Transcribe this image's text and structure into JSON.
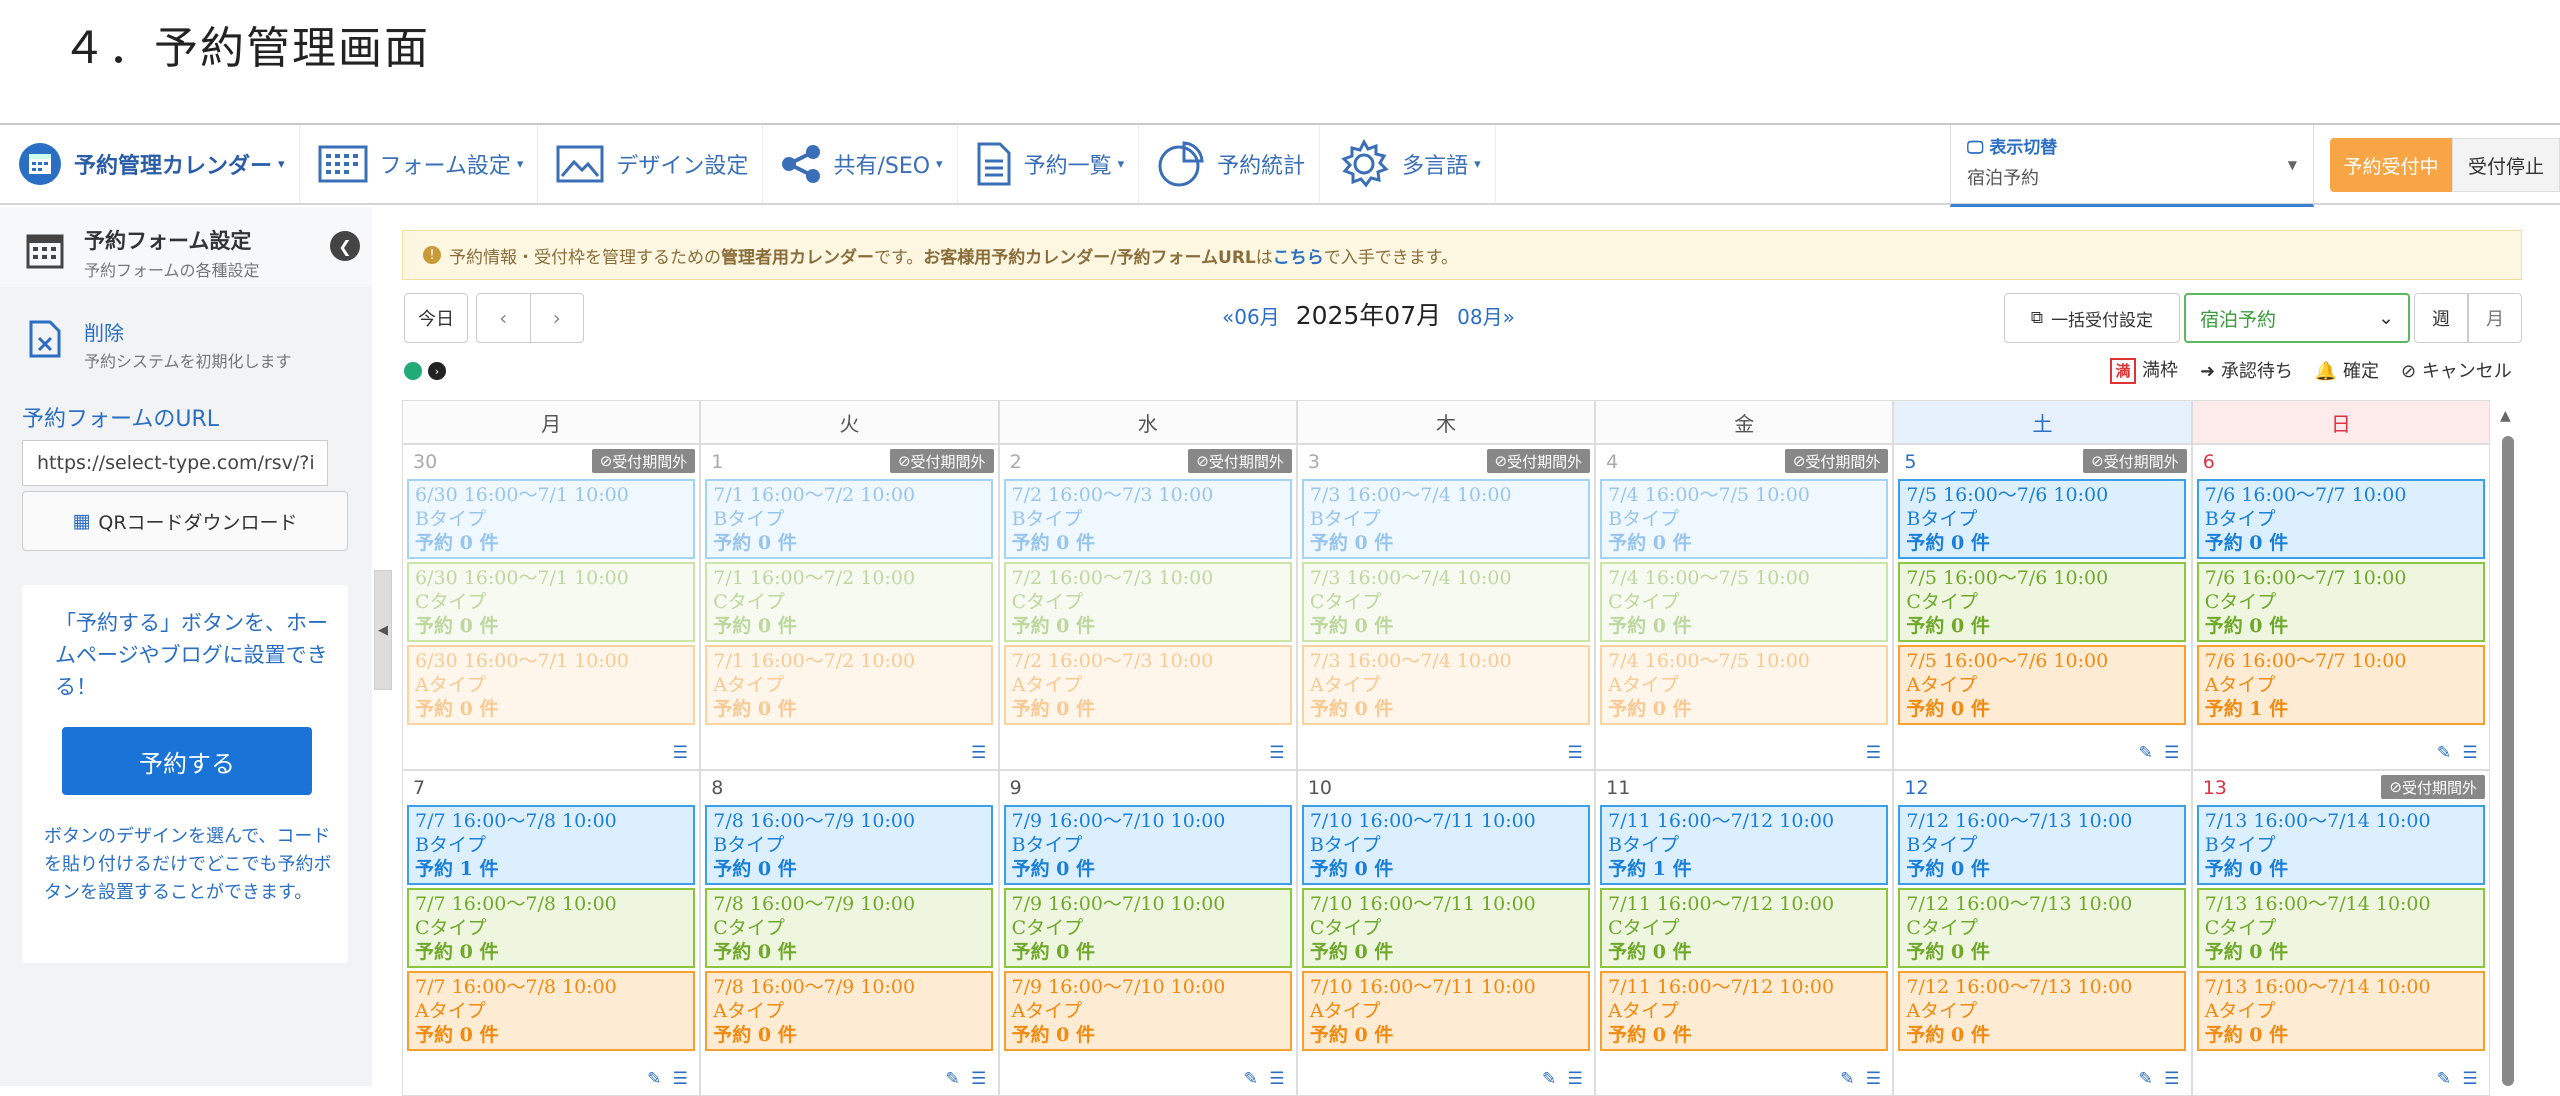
{
  "page_heading": "４．予約管理画面",
  "nav": {
    "items": [
      {
        "label": "予約管理カレンダー",
        "caret": "▾",
        "icon": "calendar-icon"
      },
      {
        "label": "フォーム設定",
        "caret": "▾",
        "icon": "form-grid-icon"
      },
      {
        "label": "デザイン設定",
        "caret": "",
        "icon": "image-frame-icon"
      },
      {
        "label": "共有/SEO",
        "caret": "▾",
        "icon": "share-icon"
      },
      {
        "label": "予約一覧",
        "caret": "▾",
        "icon": "document-icon"
      },
      {
        "label": "予約統計",
        "caret": "",
        "icon": "pie-chart-icon"
      },
      {
        "label": "多言語",
        "caret": "▾",
        "icon": "gear-icon"
      }
    ],
    "display_switch": {
      "label": "表示切替",
      "value": "宿泊予約"
    },
    "accepting_label": "予約受付中",
    "stop_label": "受付停止"
  },
  "sidebar": {
    "form_settings": {
      "title": "予約フォーム設定",
      "sub": "予約フォームの各種設定"
    },
    "delete": {
      "title": "削除",
      "sub": "予約システムを初期化します"
    },
    "url_label": "予約フォームのURL",
    "url_value": "https://select-type.com/rsv/?id",
    "qr_label": "QRコードダウンロード",
    "promo": {
      "text": "「予約する」ボタンを、ホームページやブログに設置できる！",
      "button": "予約する",
      "desc": "ボタンのデザインを選んで、コードを貼り付けるだけでどこでも予約ボタンを設置することができます。"
    }
  },
  "notice": {
    "prefix": "予約情報・受付枠を管理するための",
    "bold1": "管理者用カレンダー",
    "mid": "です。",
    "bold2": "お客様用予約カレンダー/予約フォームURL",
    "mid2": "は",
    "link": "こちら",
    "suffix": "で入手できます。"
  },
  "toolbar": {
    "today": "今日",
    "prev_month": "«06月",
    "current_month": "2025年07月",
    "next_month": "08月»",
    "bulk_label": "一括受付設定",
    "type_select": "宿泊予約",
    "week": "週",
    "month": "月"
  },
  "legend": {
    "full": "満",
    "full_label": "満枠",
    "pending": "承認待ち",
    "confirmed": "確定",
    "cancel": "キャンセル"
  },
  "calendar": {
    "weekdays": [
      "月",
      "火",
      "水",
      "木",
      "金",
      "土",
      "日"
    ],
    "out_of_period": "受付期間外",
    "weeks": [
      [
        {
          "num": "30",
          "past": true,
          "out": true,
          "slots": [
            {
              "type": "b",
              "time": "6/30 16:00～7/1 10:00",
              "name": "Bタイプ",
              "count": "予約 0 件"
            },
            {
              "type": "c",
              "time": "6/30 16:00～7/1 10:00",
              "name": "Cタイプ",
              "count": "予約 0 件"
            },
            {
              "type": "a",
              "time": "6/30 16:00～7/1 10:00",
              "name": "Aタイプ",
              "count": "予約 0 件"
            }
          ]
        },
        {
          "num": "1",
          "past": true,
          "out": true,
          "slots": [
            {
              "type": "b",
              "time": "7/1 16:00～7/2 10:00",
              "name": "Bタイプ",
              "count": "予約 0 件"
            },
            {
              "type": "c",
              "time": "7/1 16:00～7/2 10:00",
              "name": "Cタイプ",
              "count": "予約 0 件"
            },
            {
              "type": "a",
              "time": "7/1 16:00～7/2 10:00",
              "name": "Aタイプ",
              "count": "予約 0 件"
            }
          ]
        },
        {
          "num": "2",
          "past": true,
          "out": true,
          "slots": [
            {
              "type": "b",
              "time": "7/2 16:00～7/3 10:00",
              "name": "Bタイプ",
              "count": "予約 0 件"
            },
            {
              "type": "c",
              "time": "7/2 16:00～7/3 10:00",
              "name": "Cタイプ",
              "count": "予約 0 件"
            },
            {
              "type": "a",
              "time": "7/2 16:00～7/3 10:00",
              "name": "Aタイプ",
              "count": "予約 0 件"
            }
          ]
        },
        {
          "num": "3",
          "past": true,
          "out": true,
          "slots": [
            {
              "type": "b",
              "time": "7/3 16:00～7/4 10:00",
              "name": "Bタイプ",
              "count": "予約 0 件"
            },
            {
              "type": "c",
              "time": "7/3 16:00～7/4 10:00",
              "name": "Cタイプ",
              "count": "予約 0 件"
            },
            {
              "type": "a",
              "time": "7/3 16:00～7/4 10:00",
              "name": "Aタイプ",
              "count": "予約 0 件"
            }
          ]
        },
        {
          "num": "4",
          "past": true,
          "out": true,
          "slots": [
            {
              "type": "b",
              "time": "7/4 16:00～7/5 10:00",
              "name": "Bタイプ",
              "count": "予約 0 件"
            },
            {
              "type": "c",
              "time": "7/4 16:00～7/5 10:00",
              "name": "Cタイプ",
              "count": "予約 0 件"
            },
            {
              "type": "a",
              "time": "7/4 16:00～7/5 10:00",
              "name": "Aタイプ",
              "count": "予約 0 件"
            }
          ]
        },
        {
          "num": "5",
          "past": false,
          "out": true,
          "sat": true,
          "slots": [
            {
              "type": "b",
              "time": "7/5 16:00～7/6 10:00",
              "name": "Bタイプ",
              "count": "予約 0 件"
            },
            {
              "type": "c",
              "time": "7/5 16:00～7/6 10:00",
              "name": "Cタイプ",
              "count": "予約 0 件"
            },
            {
              "type": "a",
              "time": "7/5 16:00～7/6 10:00",
              "name": "Aタイプ",
              "count": "予約 0 件"
            }
          ]
        },
        {
          "num": "6",
          "past": false,
          "out": false,
          "sun": true,
          "slots": [
            {
              "type": "b",
              "time": "7/6 16:00～7/7 10:00",
              "name": "Bタイプ",
              "count": "予約 0 件"
            },
            {
              "type": "c",
              "time": "7/6 16:00～7/7 10:00",
              "name": "Cタイプ",
              "count": "予約 0 件"
            },
            {
              "type": "a",
              "time": "7/6 16:00～7/7 10:00",
              "name": "Aタイプ",
              "count": "予約 1 件"
            }
          ]
        }
      ],
      [
        {
          "num": "7",
          "past": false,
          "out": false,
          "slots": [
            {
              "type": "b",
              "time": "7/7 16:00～7/8 10:00",
              "name": "Bタイプ",
              "count": "予約 1 件"
            },
            {
              "type": "c",
              "time": "7/7 16:00～7/8 10:00",
              "name": "Cタイプ",
              "count": "予約 0 件"
            },
            {
              "type": "a",
              "time": "7/7 16:00～7/8 10:00",
              "name": "Aタイプ",
              "count": "予約 0 件"
            }
          ]
        },
        {
          "num": "8",
          "past": false,
          "out": false,
          "slots": [
            {
              "type": "b",
              "time": "7/8 16:00～7/9 10:00",
              "name": "Bタイプ",
              "count": "予約 0 件"
            },
            {
              "type": "c",
              "time": "7/8 16:00～7/9 10:00",
              "name": "Cタイプ",
              "count": "予約 0 件"
            },
            {
              "type": "a",
              "time": "7/8 16:00～7/9 10:00",
              "name": "Aタイプ",
              "count": "予約 0 件"
            }
          ]
        },
        {
          "num": "9",
          "past": false,
          "out": false,
          "slots": [
            {
              "type": "b",
              "time": "7/9 16:00～7/10 10:00",
              "name": "Bタイプ",
              "count": "予約 0 件"
            },
            {
              "type": "c",
              "time": "7/9 16:00～7/10 10:00",
              "name": "Cタイプ",
              "count": "予約 0 件"
            },
            {
              "type": "a",
              "time": "7/9 16:00～7/10 10:00",
              "name": "Aタイプ",
              "count": "予約 0 件"
            }
          ]
        },
        {
          "num": "10",
          "past": false,
          "out": false,
          "slots": [
            {
              "type": "b",
              "time": "7/10 16:00～7/11 10:00",
              "name": "Bタイプ",
              "count": "予約 0 件"
            },
            {
              "type": "c",
              "time": "7/10 16:00～7/11 10:00",
              "name": "Cタイプ",
              "count": "予約 0 件"
            },
            {
              "type": "a",
              "time": "7/10 16:00～7/11 10:00",
              "name": "Aタイプ",
              "count": "予約 0 件"
            }
          ]
        },
        {
          "num": "11",
          "past": false,
          "out": false,
          "slots": [
            {
              "type": "b",
              "time": "7/11 16:00～7/12 10:00",
              "name": "Bタイプ",
              "count": "予約 1 件"
            },
            {
              "type": "c",
              "time": "7/11 16:00～7/12 10:00",
              "name": "Cタイプ",
              "count": "予約 0 件"
            },
            {
              "type": "a",
              "time": "7/11 16:00～7/12 10:00",
              "name": "Aタイプ",
              "count": "予約 0 件"
            }
          ]
        },
        {
          "num": "12",
          "past": false,
          "out": false,
          "sat": true,
          "slots": [
            {
              "type": "b",
              "time": "7/12 16:00～7/13 10:00",
              "name": "Bタイプ",
              "count": "予約 0 件"
            },
            {
              "type": "c",
              "time": "7/12 16:00～7/13 10:00",
              "name": "Cタイプ",
              "count": "予約 0 件"
            },
            {
              "type": "a",
              "time": "7/12 16:00～7/13 10:00",
              "name": "Aタイプ",
              "count": "予約 0 件"
            }
          ]
        },
        {
          "num": "13",
          "past": false,
          "out": true,
          "sun": true,
          "slots": [
            {
              "type": "b",
              "time": "7/13 16:00～7/14 10:00",
              "name": "Bタイプ",
              "count": "予約 0 件"
            },
            {
              "type": "c",
              "time": "7/13 16:00～7/14 10:00",
              "name": "Cタイプ",
              "count": "予約 0 件"
            },
            {
              "type": "a",
              "time": "7/13 16:00～7/14 10:00",
              "name": "Aタイプ",
              "count": "予約 0 件"
            }
          ]
        }
      ]
    ]
  },
  "colors": {
    "accent": "#2a6fc4",
    "orange": "#f7a545",
    "slot_b": "#3a9ee8",
    "slot_c": "#8cc63f",
    "slot_a": "#f5a030"
  }
}
